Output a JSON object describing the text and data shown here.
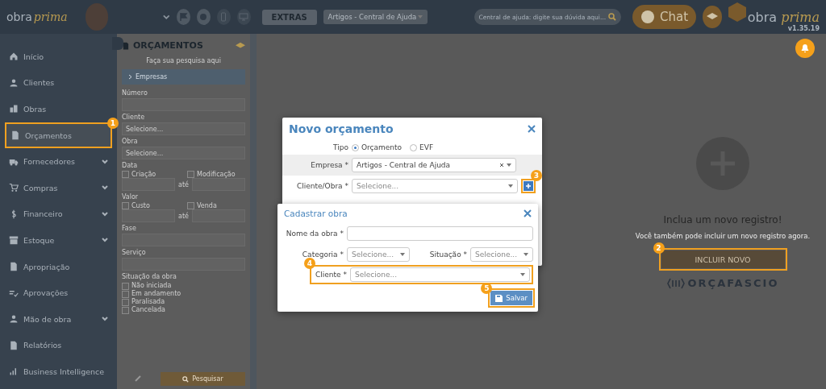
{
  "topbar": {
    "logo_a": "obra",
    "logo_b": "prima",
    "extras": "EXTRAS",
    "company": "Artigos - Central de Ajuda",
    "search_placeholder": "Central de ajuda: digite sua dúvida aqui...",
    "chat": "Chat",
    "brand_a": "obra",
    "brand_b": "prima",
    "version": "v1.35.19"
  },
  "sidebar": {
    "items": [
      {
        "label": "Início",
        "expandable": false
      },
      {
        "label": "Clientes",
        "expandable": false
      },
      {
        "label": "Obras",
        "expandable": false
      },
      {
        "label": "Orçamentos",
        "expandable": false,
        "step": "1"
      },
      {
        "label": "Fornecedores",
        "expandable": true
      },
      {
        "label": "Compras",
        "expandable": true
      },
      {
        "label": "Financeiro",
        "expandable": true
      },
      {
        "label": "Estoque",
        "expandable": true
      },
      {
        "label": "Apropriação",
        "expandable": false
      },
      {
        "label": "Aprovações",
        "expandable": false
      },
      {
        "label": "Mão de obra",
        "expandable": true
      },
      {
        "label": "Relatórios",
        "expandable": false
      },
      {
        "label": "Business Intelligence",
        "expandable": false
      }
    ]
  },
  "filters": {
    "title": "ORÇAMENTOS",
    "hint": "Faça sua pesquisa aqui",
    "section": "Empresas",
    "fields": [
      {
        "kind": "text",
        "label": "Número"
      },
      {
        "kind": "select",
        "label": "Cliente",
        "placeholder": "Selecione..."
      },
      {
        "kind": "select",
        "label": "Obra",
        "placeholder": "Selecione..."
      },
      {
        "kind": "range",
        "label": "Data",
        "left": "Criação",
        "right": "Modificação",
        "between": "até",
        "left_checked": false,
        "right_checked": false
      },
      {
        "kind": "range",
        "label": "Valor",
        "left": "Custo",
        "right": "Venda",
        "between": "até",
        "left_checked": false,
        "right_checked": false
      },
      {
        "kind": "text",
        "label": "Fase"
      },
      {
        "kind": "text",
        "label": "Serviço"
      }
    ],
    "status_label": "Situação da obra",
    "statuses": [
      {
        "label": "Não iniciada",
        "checked": false
      },
      {
        "label": "Em andamento",
        "checked": false
      },
      {
        "label": "Paralisada",
        "checked": false
      },
      {
        "label": "Cancelada",
        "checked": false
      }
    ],
    "search_button": "Pesquisar"
  },
  "empty_state": {
    "title": "Inclua um novo registro!",
    "text": "Você também pode incluir um novo registro agora.",
    "button": "INCLUIR NOVO",
    "button_step": "2",
    "brand": "ORÇAFASCIO"
  },
  "dialog": {
    "title": "Novo orçamento",
    "type_label": "Tipo",
    "types": [
      {
        "label": "Orçamento",
        "selected": true
      },
      {
        "label": "EVF",
        "selected": false
      }
    ],
    "empresa_label": "Empresa *",
    "empresa_value": "Artigos - Central de Ajuda",
    "cliente_obra_label": "Cliente/Obra *",
    "cliente_obra_placeholder": "Selecione...",
    "add_step": "3"
  },
  "subdialog": {
    "title": "Cadastrar obra",
    "nome_label": "Nome da obra *",
    "categoria_label": "Categoria *",
    "categoria_placeholder": "Selecione...",
    "situacao_label": "Situação *",
    "situacao_placeholder": "Selecione...",
    "cliente_label": "Cliente *",
    "cliente_placeholder": "Selecione...",
    "cliente_step": "4",
    "save": "Salvar",
    "save_step": "5"
  }
}
